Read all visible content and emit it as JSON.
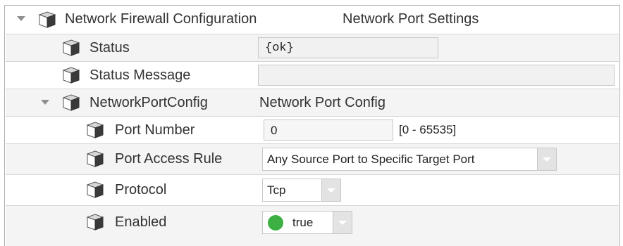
{
  "root": {
    "label": "Network Firewall Configuration",
    "type": "Network Port Settings"
  },
  "status": {
    "label": "Status",
    "value": "{ok}"
  },
  "status_message": {
    "label": "Status Message",
    "value": ""
  },
  "port_config": {
    "label": "NetworkPortConfig",
    "type": "Network Port Config"
  },
  "port_number": {
    "label": "Port Number",
    "value": "0",
    "range": "[0 - 65535]"
  },
  "port_access_rule": {
    "label": "Port Access Rule",
    "value": "Any Source Port to Specific Target Port"
  },
  "protocol": {
    "label": "Protocol",
    "value": "Tcp"
  },
  "enabled": {
    "label": "Enabled",
    "value": "true",
    "color": "#3cb043"
  },
  "icons": {
    "caret": "caret-down-icon",
    "component": "component-cube-icon"
  }
}
